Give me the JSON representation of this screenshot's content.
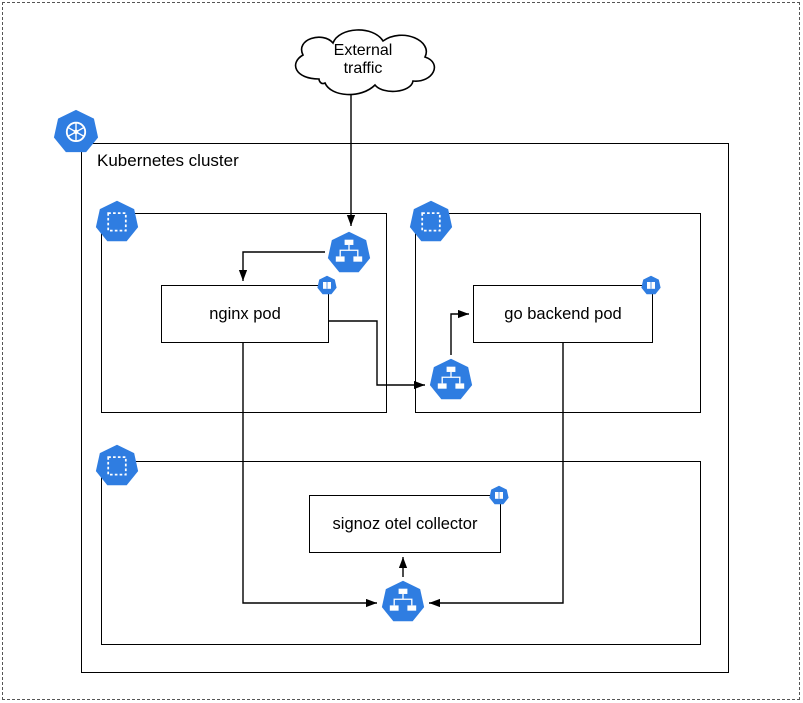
{
  "external_traffic": {
    "line1": "External",
    "line2": "traffic"
  },
  "cluster": {
    "label": "Kubernetes cluster"
  },
  "pods": {
    "nginx": "nginx pod",
    "go_backend": "go backend pod",
    "signoz": "signoz otel collector"
  },
  "colors": {
    "k8s_blue": "#2f7de1",
    "stroke": "#000"
  },
  "icons": {
    "kubernetes": "kubernetes-icon",
    "namespace": "namespace-icon",
    "service": "service-icon",
    "pod": "pod-icon"
  }
}
